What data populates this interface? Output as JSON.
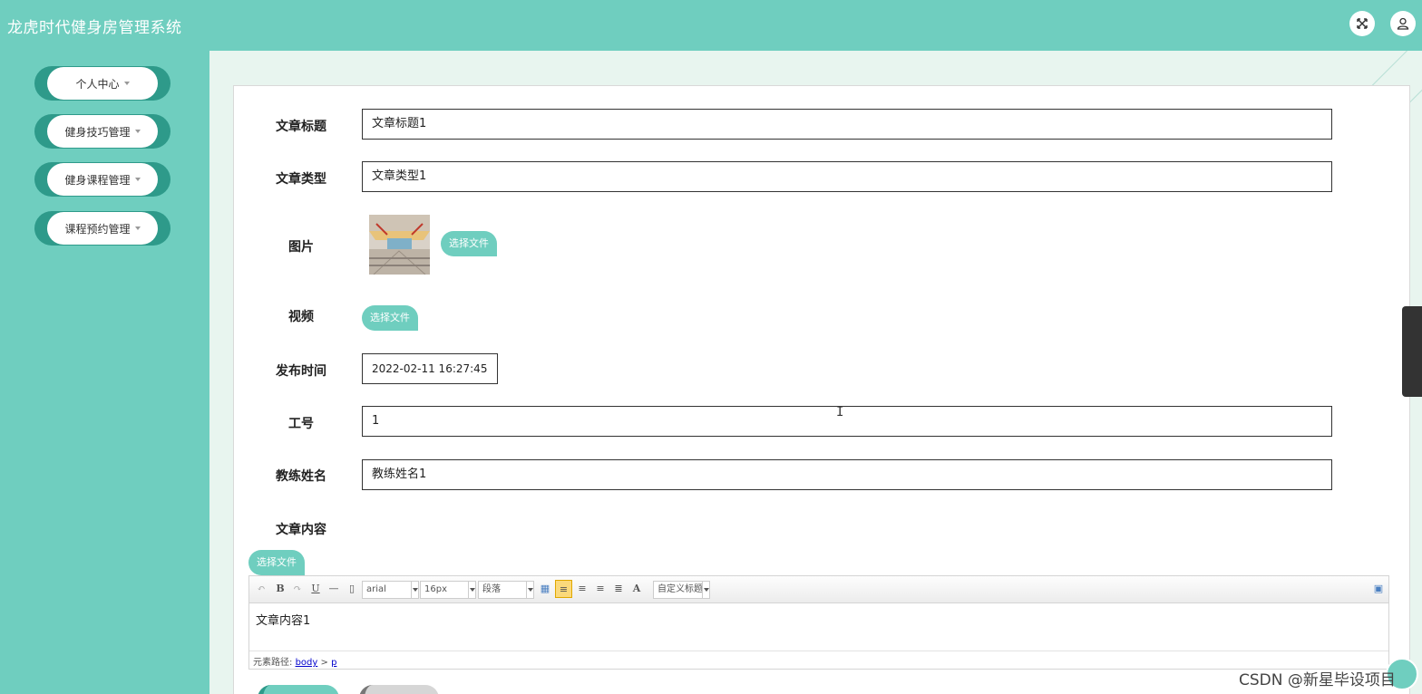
{
  "header": {
    "app_title": "龙虎时代健身房管理系统",
    "icons": [
      "fullscreen-icon",
      "user-icon"
    ]
  },
  "sidebar": {
    "items": [
      {
        "label": "个人中心"
      },
      {
        "label": "健身技巧管理"
      },
      {
        "label": "健身课程管理"
      },
      {
        "label": "课程预约管理"
      }
    ]
  },
  "form": {
    "title_label": "文章标题",
    "title_value": "文章标题1",
    "type_label": "文章类型",
    "type_value": "文章类型1",
    "image_label": "图片",
    "video_label": "视频",
    "choose_file": "选择文件",
    "publish_time_label": "发布时间",
    "publish_time_value": "2022-02-11 16:27:45",
    "job_no_label": "工号",
    "job_no_value": "1",
    "coach_name_label": "教练姓名",
    "coach_name_value": "教练姓名1",
    "content_label": "文章内容"
  },
  "editor": {
    "font_family": "arial",
    "font_size": "16px",
    "paragraph": "段落",
    "custom_title": "自定义标题",
    "content": "文章内容1",
    "path_label": "元素路径:",
    "path_body": "body",
    "path_sep": ">",
    "path_p": "p"
  },
  "watermark": "CSDN @新星毕设项目",
  "colors": {
    "primary": "#6fcebf",
    "primary_dark": "#2e9a8a",
    "main_bg": "#e8f5ef"
  }
}
